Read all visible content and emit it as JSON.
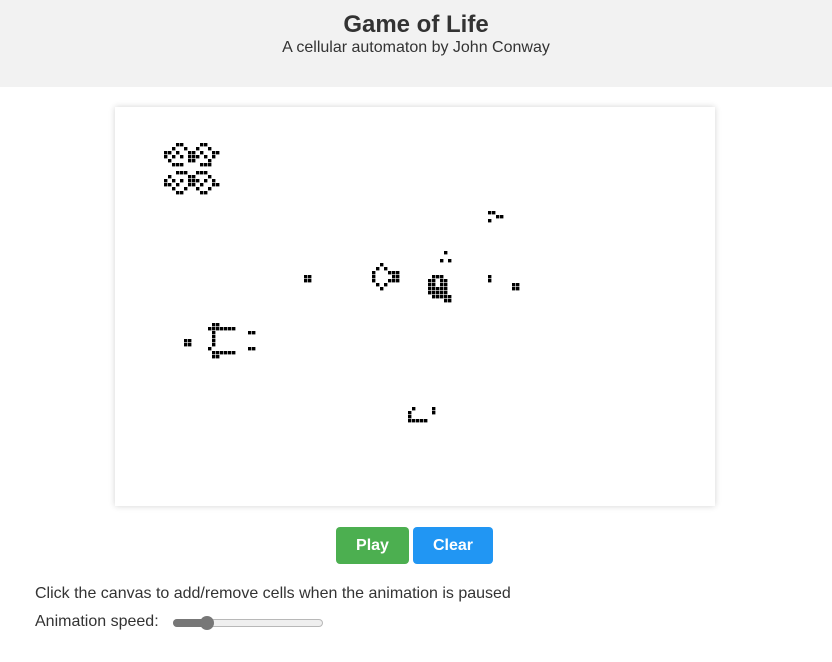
{
  "header": {
    "title": "Game of Life",
    "subtitle": "A cellular automaton by John Conway"
  },
  "controls": {
    "play_label": "Play",
    "clear_label": "Clear",
    "play_color": "#4caf50",
    "clear_color": "#2196f3"
  },
  "hint": "Click the canvas to add/remove cells when the animation is paused",
  "speed": {
    "label": "Animation speed:",
    "value": 0.2
  },
  "board": {
    "cell_color": "#000000",
    "live_cells": [
      [
        8,
        0
      ],
      [
        9,
        0
      ],
      [
        14,
        0
      ],
      [
        15,
        0
      ],
      [
        7,
        1
      ],
      [
        10,
        1
      ],
      [
        13,
        1
      ],
      [
        16,
        1
      ],
      [
        5,
        2
      ],
      [
        6,
        2
      ],
      [
        8,
        2
      ],
      [
        11,
        2
      ],
      [
        12,
        2
      ],
      [
        14,
        2
      ],
      [
        17,
        2
      ],
      [
        18,
        2
      ],
      [
        5,
        3
      ],
      [
        7,
        3
      ],
      [
        9,
        3
      ],
      [
        11,
        3
      ],
      [
        12,
        3
      ],
      [
        13,
        3
      ],
      [
        15,
        3
      ],
      [
        17,
        3
      ],
      [
        6,
        4
      ],
      [
        11,
        4
      ],
      [
        12,
        4
      ],
      [
        16,
        4
      ],
      [
        7,
        5
      ],
      [
        8,
        5
      ],
      [
        9,
        5
      ],
      [
        14,
        5
      ],
      [
        15,
        5
      ],
      [
        16,
        5
      ],
      [
        8,
        7
      ],
      [
        9,
        7
      ],
      [
        10,
        7
      ],
      [
        13,
        7
      ],
      [
        14,
        7
      ],
      [
        15,
        7
      ],
      [
        6,
        8
      ],
      [
        11,
        8
      ],
      [
        12,
        8
      ],
      [
        16,
        8
      ],
      [
        5,
        9
      ],
      [
        7,
        9
      ],
      [
        9,
        9
      ],
      [
        11,
        9
      ],
      [
        12,
        9
      ],
      [
        13,
        9
      ],
      [
        15,
        9
      ],
      [
        17,
        9
      ],
      [
        5,
        10
      ],
      [
        6,
        10
      ],
      [
        8,
        10
      ],
      [
        11,
        10
      ],
      [
        12,
        10
      ],
      [
        14,
        10
      ],
      [
        17,
        10
      ],
      [
        18,
        10
      ],
      [
        7,
        11
      ],
      [
        10,
        11
      ],
      [
        13,
        11
      ],
      [
        16,
        11
      ],
      [
        8,
        12
      ],
      [
        9,
        12
      ],
      [
        14,
        12
      ],
      [
        15,
        12
      ],
      [
        86,
        17
      ],
      [
        87,
        17
      ],
      [
        88,
        18
      ],
      [
        89,
        18
      ],
      [
        86,
        19
      ],
      [
        75,
        27
      ],
      [
        74,
        29
      ],
      [
        76,
        29
      ],
      [
        59,
        30
      ],
      [
        58,
        31
      ],
      [
        60,
        31
      ],
      [
        57,
        32
      ],
      [
        61,
        32
      ],
      [
        62,
        32
      ],
      [
        63,
        32
      ],
      [
        40,
        33
      ],
      [
        41,
        33
      ],
      [
        57,
        33
      ],
      [
        62,
        33
      ],
      [
        63,
        33
      ],
      [
        72,
        33
      ],
      [
        73,
        33
      ],
      [
        74,
        33
      ],
      [
        86,
        33
      ],
      [
        40,
        34
      ],
      [
        41,
        34
      ],
      [
        57,
        34
      ],
      [
        61,
        34
      ],
      [
        62,
        34
      ],
      [
        63,
        34
      ],
      [
        71,
        34
      ],
      [
        72,
        34
      ],
      [
        74,
        34
      ],
      [
        75,
        34
      ],
      [
        86,
        34
      ],
      [
        58,
        35
      ],
      [
        60,
        35
      ],
      [
        71,
        35
      ],
      [
        72,
        35
      ],
      [
        74,
        35
      ],
      [
        75,
        35
      ],
      [
        92,
        35
      ],
      [
        93,
        35
      ],
      [
        59,
        36
      ],
      [
        71,
        36
      ],
      [
        72,
        36
      ],
      [
        73,
        36
      ],
      [
        74,
        36
      ],
      [
        75,
        36
      ],
      [
        92,
        36
      ],
      [
        93,
        36
      ],
      [
        71,
        37
      ],
      [
        72,
        37
      ],
      [
        73,
        37
      ],
      [
        74,
        37
      ],
      [
        75,
        37
      ],
      [
        72,
        38
      ],
      [
        73,
        38
      ],
      [
        74,
        38
      ],
      [
        75,
        38
      ],
      [
        76,
        38
      ],
      [
        75,
        39
      ],
      [
        76,
        39
      ],
      [
        17,
        45
      ],
      [
        18,
        45
      ],
      [
        16,
        46
      ],
      [
        17,
        46
      ],
      [
        18,
        46
      ],
      [
        19,
        46
      ],
      [
        20,
        46
      ],
      [
        21,
        46
      ],
      [
        22,
        46
      ],
      [
        17,
        47
      ],
      [
        26,
        47
      ],
      [
        27,
        47
      ],
      [
        17,
        48
      ],
      [
        10,
        49
      ],
      [
        11,
        49
      ],
      [
        17,
        49
      ],
      [
        10,
        50
      ],
      [
        11,
        50
      ],
      [
        17,
        50
      ],
      [
        16,
        51
      ],
      [
        26,
        51
      ],
      [
        27,
        51
      ],
      [
        17,
        52
      ],
      [
        18,
        52
      ],
      [
        19,
        52
      ],
      [
        20,
        52
      ],
      [
        21,
        52
      ],
      [
        22,
        52
      ],
      [
        17,
        53
      ],
      [
        18,
        53
      ],
      [
        67,
        66
      ],
      [
        72,
        66
      ],
      [
        66,
        67
      ],
      [
        72,
        67
      ],
      [
        66,
        68
      ],
      [
        66,
        69
      ],
      [
        67,
        69
      ],
      [
        68,
        69
      ],
      [
        69,
        69
      ],
      [
        70,
        69
      ]
    ]
  }
}
